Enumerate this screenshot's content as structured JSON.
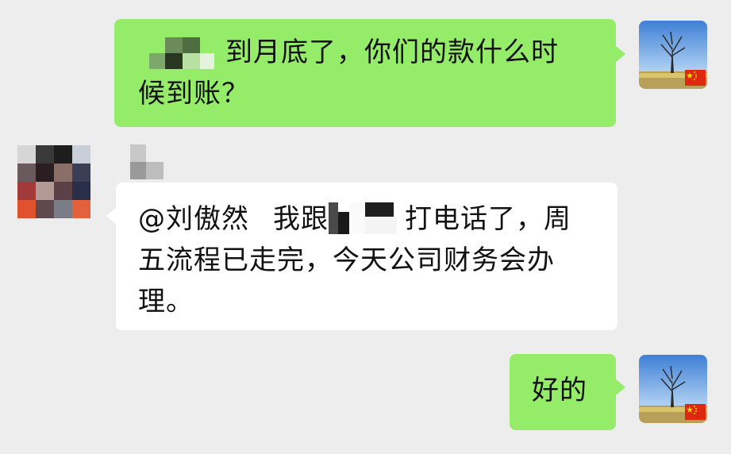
{
  "messages": [
    {
      "side": "out",
      "text_before_mosaic": "",
      "text": "到月底了，你们的款什么时候到账？"
    },
    {
      "side": "in",
      "mention": "@刘傲然",
      "text_a": "我跟",
      "text_b": "打电话了，周五流程已走完，今天公司财务会办理。"
    },
    {
      "side": "out",
      "text": "好的"
    }
  ],
  "lines": {
    "m1_l1": "到月底了，你们的款什么时",
    "m1_l2": "候到账？",
    "m2_l1_mention": "@刘傲然",
    "m2_l1_a": "我跟",
    "m2_l1_b": "打电话了，周",
    "m2_l2": "五流程已走完，今天公司财务会办",
    "m2_l3": "理。",
    "m3": "好的"
  },
  "colors": {
    "background": "#ededed",
    "outgoing_bubble": "#95ec69",
    "incoming_bubble": "#ffffff"
  },
  "icons": {
    "self_avatar": "tree-landscape-avatar",
    "flag": "china-flag-icon"
  }
}
